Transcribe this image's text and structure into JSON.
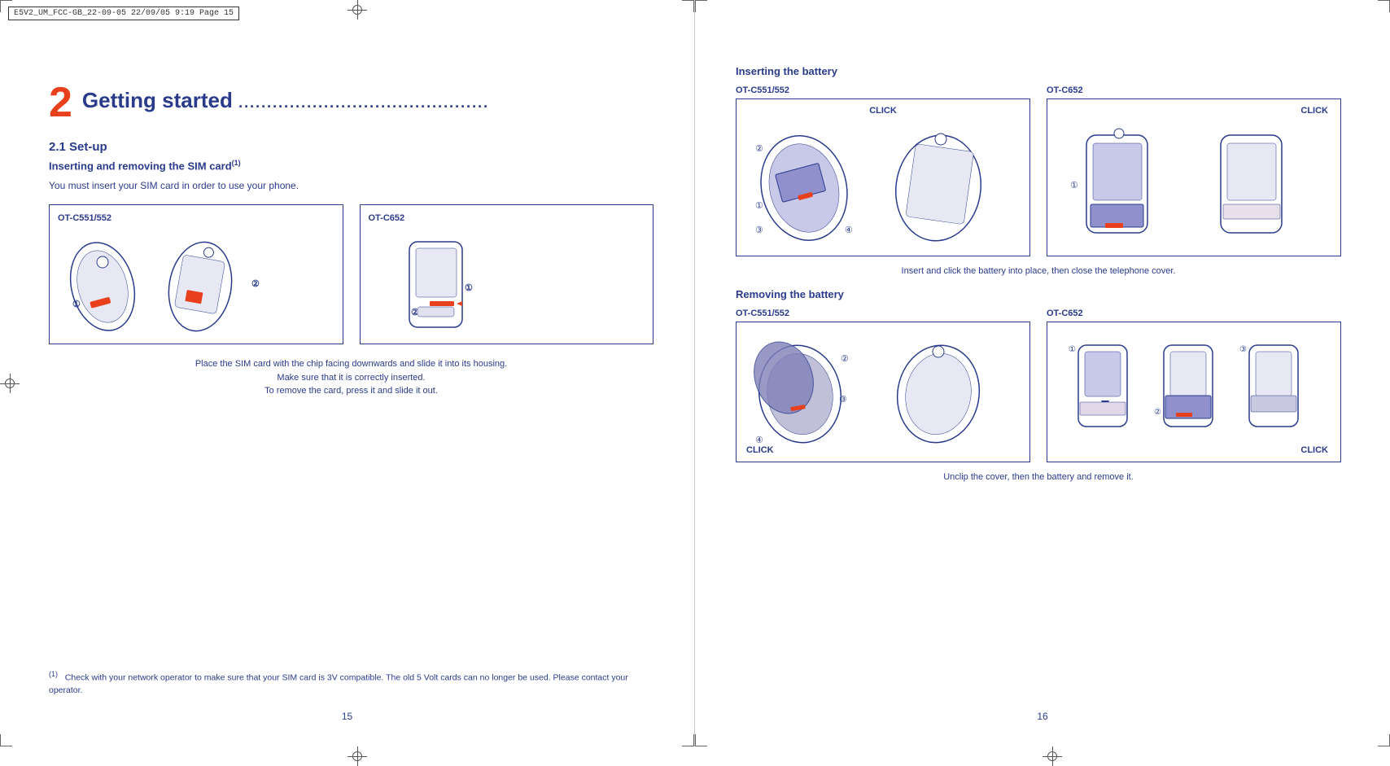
{
  "left_page": {
    "file_header": "E5V2_UM_FCC-GB_22-09-05   22/09/05   9:19   Page 15",
    "chapter_number": "2",
    "chapter_title": "Getting started",
    "chapter_dots": "............................................",
    "section_2_1": "2.1   Set-up",
    "subsection_inserting": "Inserting and removing the SIM card",
    "superscript_1": "(1)",
    "body_text": "You must insert your SIM card in order to use your phone.",
    "device_label_ot_c551_552": "OT-C551/552",
    "device_label_ot_c652": "OT-C652",
    "caption_line1": "Place the SIM card with the chip facing downwards and slide it into its housing.",
    "caption_line2": "Make sure that it is correctly inserted.",
    "caption_line3": "To remove the card, press it and slide it out.",
    "footnote_marker": "(1)",
    "footnote_text": "Check with your network operator to make sure that your SIM card is 3V compatible. The old 5 Volt cards can no longer be used. Please contact your operator.",
    "page_number": "15"
  },
  "right_page": {
    "inserting_battery_title": "Inserting the battery",
    "ot_c551_552": "OT-C551/552",
    "ot_c652": "OT-C652",
    "click_label_insert": "CLICK",
    "click_label_insert_right": "CLICK",
    "insert_caption": "Insert and click the battery into place, then close the telephone cover.",
    "removing_battery_title": "Removing the battery",
    "ot_c551_552_remove": "OT-C551/552",
    "ot_c652_remove": "OT-C652",
    "click_label_remove_left": "CLICK",
    "click_label_remove_right": "CLICK",
    "remove_caption": "Unclip the cover, then the battery and remove it.",
    "page_number": "16"
  }
}
